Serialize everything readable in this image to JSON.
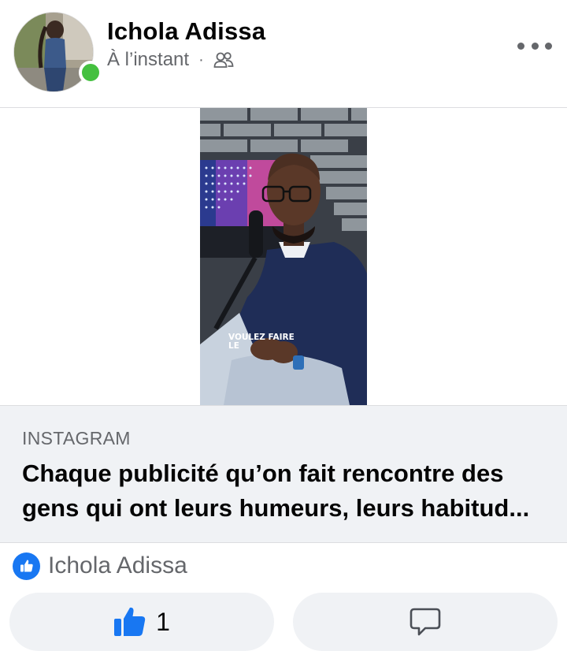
{
  "post": {
    "author": "Ichola Adissa",
    "time": "À l’instant",
    "audience_icon": "friends-icon",
    "more_icon": "more-icon"
  },
  "media": {
    "overlay_text": "VOULEZ FAIRE\nLE"
  },
  "link_preview": {
    "source": "INSTAGRAM",
    "title": "Chaque publicité qu’on fait rencontre des gens qui ont leurs humeurs, leurs habitud..."
  },
  "reactions": {
    "icon": "like-icon",
    "reactor": "Ichola Adissa"
  },
  "actions": {
    "like_icon": "thumbs-up-icon",
    "like_count": "1",
    "comment_icon": "comment-icon"
  },
  "colors": {
    "accent": "#1877f2",
    "online": "#44c03f",
    "card_bg": "#f0f2f5",
    "muted_text": "#65676b"
  }
}
